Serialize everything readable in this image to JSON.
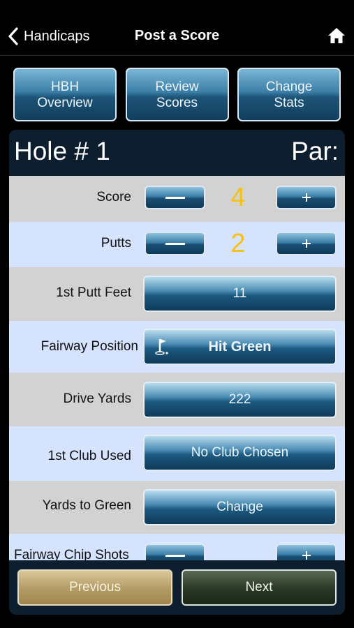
{
  "nav": {
    "back_label": "Handicaps",
    "title": "Post a Score"
  },
  "tiles": [
    {
      "label": "HBH\nOverview"
    },
    {
      "label": "Review\nScores"
    },
    {
      "label": "Change\nStats"
    }
  ],
  "header": {
    "hole": "Hole # 1",
    "par": "Par:"
  },
  "rows": {
    "score": {
      "label": "Score",
      "value": "4"
    },
    "putts": {
      "label": "Putts",
      "value": "2"
    },
    "first_putt": {
      "label": "1st Putt Feet",
      "value": "11"
    },
    "fairway": {
      "label": "Fairway Position",
      "value": "Hit Green"
    },
    "drive": {
      "label": "Drive Yards",
      "value": "222"
    },
    "club": {
      "label": "1st Club Used",
      "value": "No Club Chosen"
    },
    "yards_green": {
      "label": "Yards to Green",
      "value": "Change"
    },
    "chip": {
      "label": "Fairway Chip Shots"
    }
  },
  "footer": {
    "previous": "Previous",
    "next": "Next"
  },
  "colors": {
    "counter": "#f5c116",
    "row_gray": "#d2d2d2",
    "row_blue": "#d6e3fd"
  }
}
